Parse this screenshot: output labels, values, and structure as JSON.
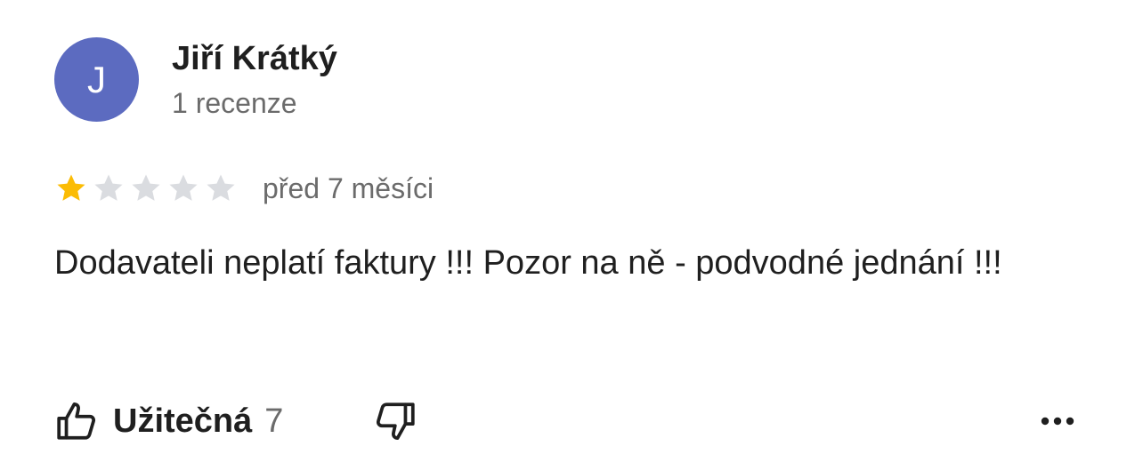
{
  "review": {
    "author": {
      "initial": "J",
      "name": "Jiří Krátký",
      "review_count_label": "1 recenze",
      "avatar_color": "#5c6bc0"
    },
    "rating": {
      "value": 1,
      "max": 5,
      "filled_color": "#fbbc04",
      "empty_color": "#dadce0"
    },
    "date": "před 7 měsíci",
    "text": "Dodavateli neplatí faktury !!! Pozor na ně - podvodné jednání !!!",
    "actions": {
      "helpful_label": "Užitečná",
      "helpful_count": "7",
      "helpful_icon": "thumbs-up-icon",
      "unhelpful_icon": "thumbs-down-icon",
      "more_icon": "more-horizontal-icon"
    }
  }
}
